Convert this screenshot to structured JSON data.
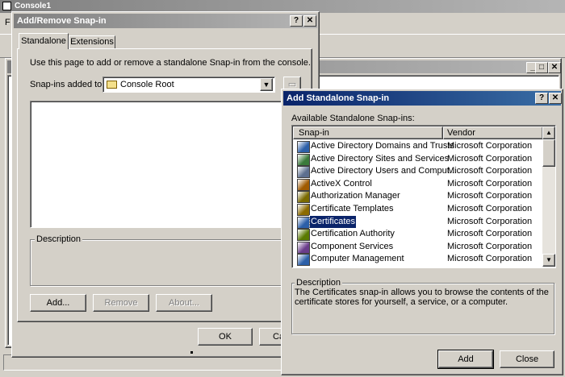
{
  "console": {
    "title": "Console1",
    "menu_letter": "F"
  },
  "add_remove": {
    "title": "Add/Remove Snap-in",
    "tabs": [
      "Standalone",
      "Extensions"
    ],
    "intro": "Use this page to add or remove a standalone Snap-in from the console.",
    "snapins_label": "Snap-ins added to:",
    "snapins_value": "Console Root",
    "description_label": "Description",
    "add_button": "Add...",
    "remove_button": "Remove",
    "about_button": "About...",
    "ok_button": "OK",
    "cancel_button": "Ca"
  },
  "standalone": {
    "title": "Add Standalone Snap-in",
    "available_label": "Available Standalone Snap-ins:",
    "columns": [
      "Snap-in",
      "Vendor"
    ],
    "rows": [
      {
        "name": "Active Directory Domains and Trusts",
        "vendor": "Microsoft Corporation",
        "icon": "ad-domains-icon"
      },
      {
        "name": "Active Directory Sites and Services",
        "vendor": "Microsoft Corporation",
        "icon": "ad-sites-icon"
      },
      {
        "name": "Active Directory Users and Comput...",
        "vendor": "Microsoft Corporation",
        "icon": "ad-users-icon"
      },
      {
        "name": "ActiveX Control",
        "vendor": "Microsoft Corporation",
        "icon": "activex-icon"
      },
      {
        "name": "Authorization Manager",
        "vendor": "Microsoft Corporation",
        "icon": "authorization-icon"
      },
      {
        "name": "Certificate Templates",
        "vendor": "Microsoft Corporation",
        "icon": "cert-templates-icon"
      },
      {
        "name": "Certificates",
        "vendor": "Microsoft Corporation",
        "icon": "certificates-icon",
        "selected": true
      },
      {
        "name": "Certification Authority",
        "vendor": "Microsoft Corporation",
        "icon": "cert-authority-icon"
      },
      {
        "name": "Component Services",
        "vendor": "Microsoft Corporation",
        "icon": "component-services-icon"
      },
      {
        "name": "Computer Management",
        "vendor": "Microsoft Corporation",
        "icon": "computer-management-icon"
      }
    ],
    "description_label": "Description",
    "description_text": "The Certificates snap-in allows you to browse the contents of the certificate stores for yourself, a service, or a computer.",
    "add_button": "Add",
    "close_button": "Close"
  },
  "colors": {
    "title_active": "#0a246a",
    "title_inactive": "#808080",
    "face": "#d4d0c8",
    "selection": "#0a246a"
  }
}
